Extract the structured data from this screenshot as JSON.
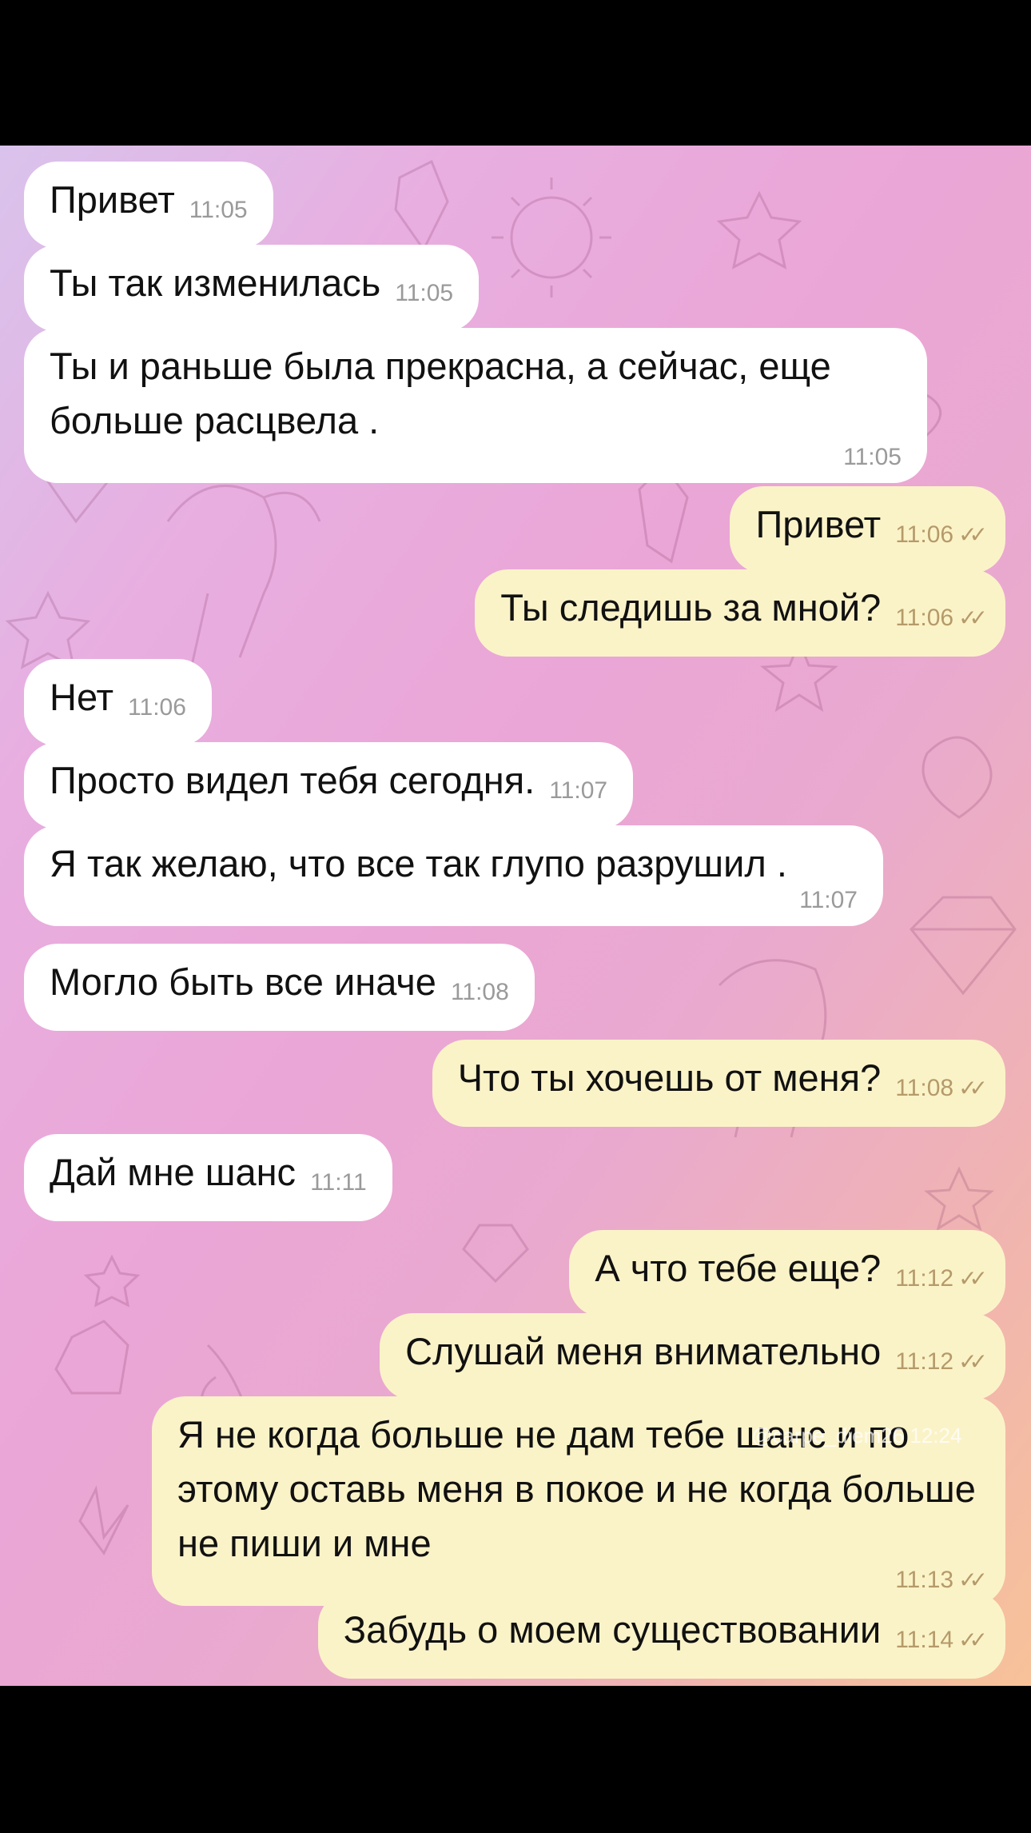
{
  "messages": [
    {
      "dir": "in",
      "text": "Привет",
      "time": "11:05"
    },
    {
      "dir": "in",
      "text": "Ты так изменилась",
      "time": "11:05"
    },
    {
      "dir": "in",
      "text": "Ты и раньше была прекрасна, а сейчас, еще больше расцвела .",
      "time": "11:05"
    },
    {
      "dir": "out",
      "text": "Привет",
      "time": "11:06"
    },
    {
      "dir": "out",
      "text": "Ты следишь за мной?",
      "time": "11:06"
    },
    {
      "dir": "in",
      "text": "Нет",
      "time": "11:06"
    },
    {
      "dir": "in",
      "text": "Просто видел тебя сегодня.",
      "time": "11:07"
    },
    {
      "dir": "in",
      "text": "Я так желаю, что все так глупо разрушил .",
      "time": "11:07"
    },
    {
      "dir": "in",
      "text": "Могло быть все иначе",
      "time": "11:08"
    },
    {
      "dir": "out",
      "text": "Что ты хочешь от меня?",
      "time": "11:08"
    },
    {
      "dir": "in",
      "text": "Дай мне шанс",
      "time": "11:11"
    },
    {
      "dir": "out",
      "text": "А что тебе еще?",
      "time": "11:12"
    },
    {
      "dir": "out",
      "text": "Слушай меня внимательно",
      "time": "11:12"
    },
    {
      "dir": "out",
      "text": "Я не когда больше не дам тебе шанс и по этому оставь меня в покое и не когда больше не пиши и мне",
      "time": "11:13"
    },
    {
      "dir": "out",
      "text": "Забудь о моем существовании",
      "time": "11:14"
    }
  ],
  "read_receipt_icon": "double-check-icon",
  "watermark": "@carpe_diem26 12:24",
  "colors": {
    "incoming_bubble": "#ffffff",
    "outgoing_bubble": "#fbf3c8",
    "time_incoming": "#9a9a9a",
    "time_outgoing": "#b59a6a"
  }
}
